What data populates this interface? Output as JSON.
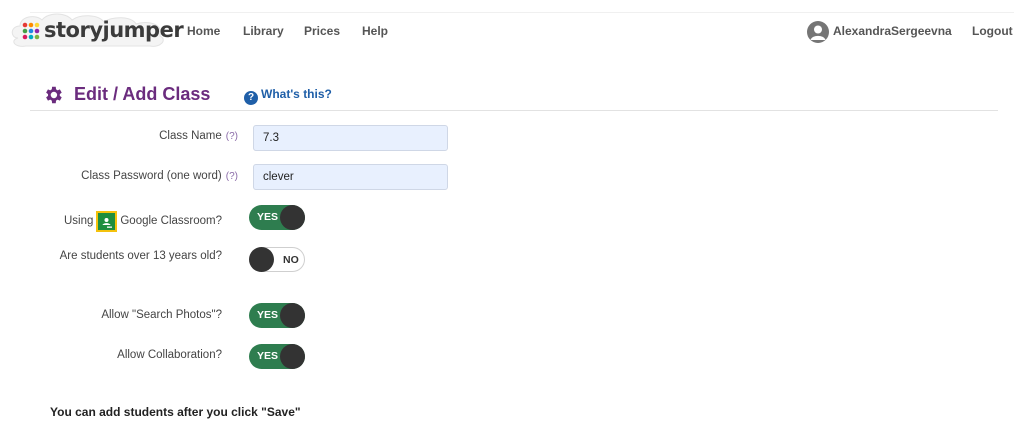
{
  "header": {
    "logo_text": "storyjumper",
    "nav": [
      "Home",
      "Library",
      "Prices",
      "Help"
    ],
    "user_name": "AlexandraSergeevna",
    "logout_label": "Logout"
  },
  "page": {
    "title": "Edit / Add Class",
    "whats_this": "What's this?",
    "title_color": "#6b2c7e",
    "link_color": "#1f5fa8"
  },
  "form": {
    "class_name": {
      "label": "Class Name",
      "help": "(?)",
      "value": "7.3"
    },
    "class_password": {
      "label": "Class Password (one word)",
      "help": "(?)",
      "value": "clever"
    },
    "google_classroom": {
      "label_before": "Using",
      "label_after": "Google Classroom?",
      "state": "YES",
      "icon": "google-classroom-icon"
    },
    "students_over_13": {
      "label": "Are students over 13 years old?",
      "state": "NO"
    },
    "search_photos": {
      "label": "Allow \"Search Photos\"?",
      "state": "YES"
    },
    "collaboration": {
      "label": "Allow Collaboration?",
      "state": "YES"
    },
    "toggle_on_color": "#2e7d4f"
  },
  "footer_note": "You can add students after you click \"Save\""
}
